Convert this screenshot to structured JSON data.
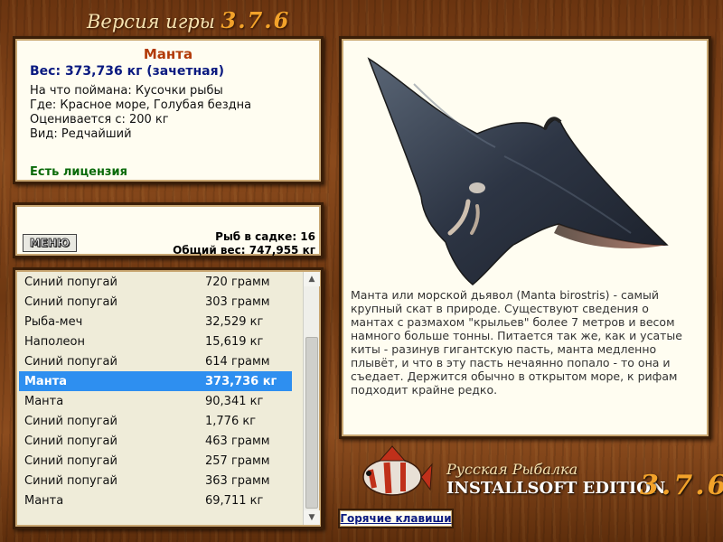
{
  "title": {
    "prefix": "Версия игры",
    "version": "3.7.6"
  },
  "fish_info": {
    "name": "Манта",
    "weight": "Вес: 373,736 кг (зачетная)",
    "lines": [
      "На что поймана: Кусочки рыбы",
      "Где: Красное море, Голубая бездна",
      "Оценивается с: 200 кг",
      "Вид: Редчайший"
    ],
    "license": "Есть лицензия"
  },
  "cage": {
    "menu_label": "МЕНЮ",
    "fish_count": "Рыб в садке: 16",
    "total_weight": "Общий вес: 747,955 кг"
  },
  "fish_list": [
    {
      "name": "Синий попугай",
      "weight": "720 грамм"
    },
    {
      "name": "Синий попугай",
      "weight": "303 грамм"
    },
    {
      "name": "Рыба-меч",
      "weight": "32,529 кг"
    },
    {
      "name": "Наполеон",
      "weight": "15,619 кг"
    },
    {
      "name": "Синий попугай",
      "weight": "614 грамм"
    },
    {
      "name": "Манта",
      "weight": "373,736 кг",
      "selected": true
    },
    {
      "name": "Манта",
      "weight": "90,341 кг"
    },
    {
      "name": "Синий попугай",
      "weight": "1,776 кг"
    },
    {
      "name": "Синий попугай",
      "weight": "463 грамм"
    },
    {
      "name": "Синий попугай",
      "weight": "257 грамм"
    },
    {
      "name": "Синий попугай",
      "weight": "363 грамм"
    },
    {
      "name": "Манта",
      "weight": "69,711 кг"
    }
  ],
  "description": "Манта или морской дьявол (Manta birostris) - самый крупный скат в природе. Существуют сведения о мантах с размахом \"крыльев\" более 7 метров и весом намного больше тонны. Питается так же, как и усатые киты - разинув гигантскую пасть, манта медленно плывёт, и что в эту пасть нечаянно попало - то она и съедает. Держится обычно в открытом море, к рифам подходит крайне редко.",
  "logo": {
    "line1": "Русская Рыбалка",
    "line2": "INSTALLSOFT EDITION",
    "version": "3.7.6"
  },
  "hotkeys_label": "Горячие клавиши",
  "colors": {
    "selected_row": "#2e8ff0",
    "fish_name": "#b23a08",
    "weight_text": "#0a1a80",
    "license": "#0a6a0a",
    "version_accent": "#f2a22a"
  }
}
